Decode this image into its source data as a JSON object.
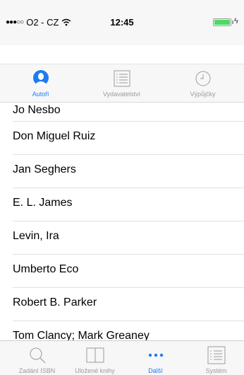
{
  "status": {
    "signal": "●●●○○",
    "carrier": "O2 - CZ",
    "time": "12:45"
  },
  "segments": [
    {
      "label": "Autoři",
      "icon": "person-icon",
      "active": true
    },
    {
      "label": "Vydavatelství",
      "icon": "list-icon",
      "active": false
    },
    {
      "label": "Výpůjčky",
      "icon": "clock-icon",
      "active": false
    }
  ],
  "authors": [
    "Jo Nesbo",
    "Don Miguel Ruiz",
    "Jan Seghers",
    "E. L. James",
    "Levin, Ira",
    "Umberto Eco",
    "Robert B. Parker",
    "Tom Clancy; Mark Greaney"
  ],
  "tabs": [
    {
      "label": "Zadání ISBN",
      "icon": "search-icon",
      "active": false
    },
    {
      "label": "Uložené knihy",
      "icon": "book-icon",
      "active": false
    },
    {
      "label": "Další",
      "icon": "more-icon",
      "active": true
    },
    {
      "label": "Systém",
      "icon": "list-icon",
      "active": false
    }
  ],
  "colors": {
    "accent": "#1e7cf2",
    "inactive": "#9b9b9b",
    "battery": "#4cd964"
  }
}
